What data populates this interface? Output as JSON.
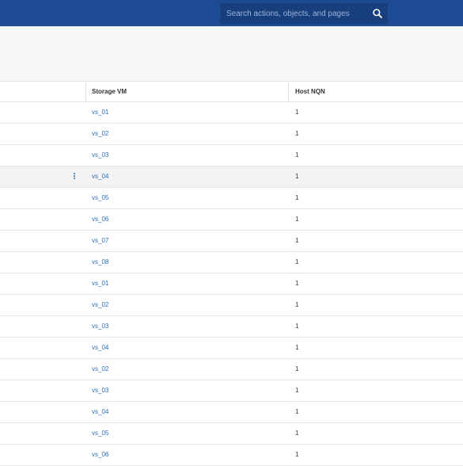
{
  "header": {
    "search_placeholder": "Search actions, objects, and pages"
  },
  "table": {
    "columns": [
      "Storage VM",
      "Host NQN"
    ],
    "rows": [
      {
        "storage_vm": "vs_01",
        "host_nqn": "1"
      },
      {
        "storage_vm": "vs_02",
        "host_nqn": "1"
      },
      {
        "storage_vm": "vs_03",
        "host_nqn": "1"
      },
      {
        "storage_vm": "vs_04",
        "host_nqn": "1",
        "selected": true
      },
      {
        "storage_vm": "vs_05",
        "host_nqn": "1"
      },
      {
        "storage_vm": "vs_06",
        "host_nqn": "1"
      },
      {
        "storage_vm": "vs_07",
        "host_nqn": "1"
      },
      {
        "storage_vm": "vs_08",
        "host_nqn": "1"
      },
      {
        "storage_vm": "vs_01",
        "host_nqn": "1"
      },
      {
        "storage_vm": "vs_02",
        "host_nqn": "1"
      },
      {
        "storage_vm": "vs_03",
        "host_nqn": "1"
      },
      {
        "storage_vm": "vs_04",
        "host_nqn": "1"
      },
      {
        "storage_vm": "vs_02",
        "host_nqn": "1"
      },
      {
        "storage_vm": "vs_03",
        "host_nqn": "1"
      },
      {
        "storage_vm": "vs_04",
        "host_nqn": "1"
      },
      {
        "storage_vm": "vs_05",
        "host_nqn": "1"
      },
      {
        "storage_vm": "vs_06",
        "host_nqn": "1"
      }
    ]
  },
  "colors": {
    "topbar": "#1c4a93",
    "search_bg": "#173f7e",
    "link": "#2a6ebb"
  },
  "icons": {
    "search": "search-icon",
    "row_menu": "more-vertical-icon"
  }
}
